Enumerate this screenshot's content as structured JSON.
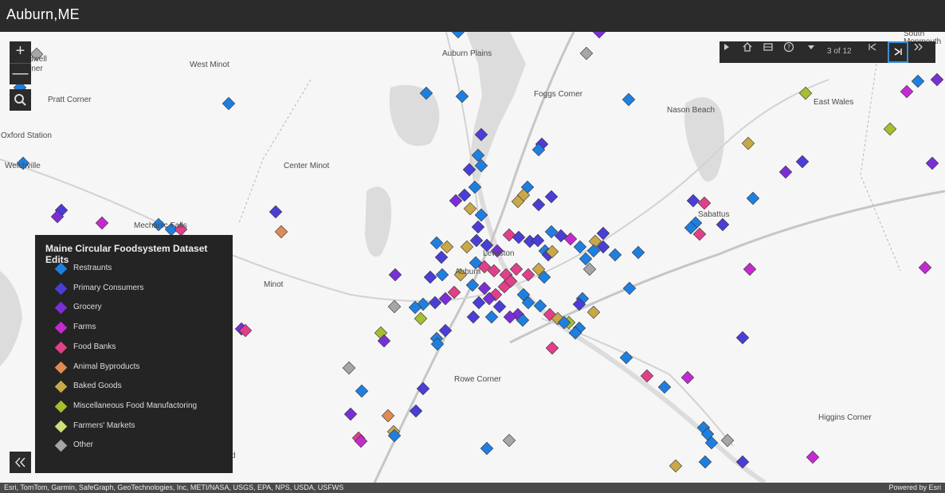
{
  "header": {
    "title": "Auburn,ME"
  },
  "map": {
    "place_labels": [
      "Auburn Plains",
      "Foggs Corner",
      "West Minot",
      "Pratt Corner",
      "Nason Beach",
      "East Wales",
      "Oxford Station",
      "Welchville",
      "Center Minot",
      "Sabattus",
      "Mechanic Falls",
      "Lewiston",
      "Auburn",
      "Minot",
      "Rowe Corner",
      "Higgins Corner",
      "South Monmouth",
      "dwell",
      "rner",
      "d"
    ]
  },
  "toolbar": {
    "count_text": "3 of 12"
  },
  "legend": {
    "title": "Maine Circular Foodsystem Dataset Edits",
    "items": [
      {
        "label": "Restraunts",
        "color": "#1e7fe0"
      },
      {
        "label": "Primary Consumers",
        "color": "#4a3ed6"
      },
      {
        "label": "Grocery",
        "color": "#7a2fd6"
      },
      {
        "label": "Farms",
        "color": "#c42ad0"
      },
      {
        "label": "Food Banks",
        "color": "#e0408a"
      },
      {
        "label": "Animal Byproducts",
        "color": "#e08a55"
      },
      {
        "label": "Baked Goods",
        "color": "#c9a848"
      },
      {
        "label": "Miscellaneous Food Manufactoring",
        "color": "#a6be2f"
      },
      {
        "label": "Farmers' Markets",
        "color": "#cce07a"
      },
      {
        "label": "Other",
        "color": "#a6a6a6"
      }
    ]
  },
  "footer": {
    "attribution": "Esri, TomTom, Garmin, SafeGraph, GeoTechnologies, Inc, METI/NASA, USGS, EPA, NPS, USDA, USFWS",
    "powered_by": "Powered by Esri"
  }
}
